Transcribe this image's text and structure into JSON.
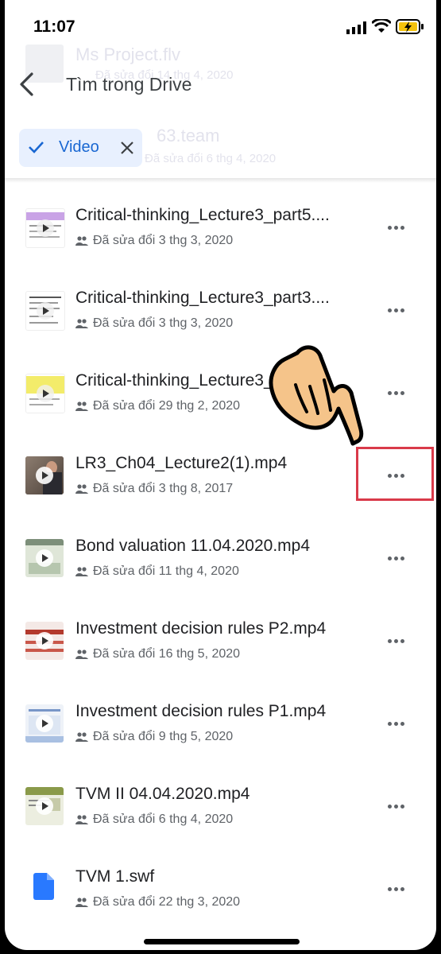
{
  "status_bar": {
    "time": "11:07"
  },
  "header": {
    "title": "Tìm trong Drive"
  },
  "filter_chip": {
    "label": "Video"
  },
  "background_ghost": [
    {
      "name": "Ms Project.flv",
      "meta": "Đã sửa đổi 14 thg 4, 2020"
    },
    {
      "name": "63.team",
      "meta": "Đã sửa đổi 6 thg 4, 2020"
    }
  ],
  "files": [
    {
      "name": "Critical-thinking_Lecture3_part5....",
      "meta": "Đã sửa đổi 3 thg 3, 2020",
      "thumb": "doc-purple"
    },
    {
      "name": "Critical-thinking_Lecture3_part3....",
      "meta": "Đã sửa đổi 3 thg 3, 2020",
      "thumb": "doc-white"
    },
    {
      "name": "Critical-thinking_Lecture3_part3....",
      "meta": "Đã sửa đổi 29 thg 2, 2020",
      "thumb": "doc-yellow"
    },
    {
      "name": "LR3_Ch04_Lecture2(1).mp4",
      "meta": "Đã sửa đổi 3 thg 8, 2017",
      "thumb": "video-person"
    },
    {
      "name": "Bond valuation 11.04.2020.mp4",
      "meta": "Đã sửa đổi 11 thg 4, 2020",
      "thumb": "video-green"
    },
    {
      "name": "Investment decision rules P2.mp4",
      "meta": "Đã sửa đổi 16 thg 5, 2020",
      "thumb": "video-red"
    },
    {
      "name": "Investment decision rules P1.mp4",
      "meta": "Đã sửa đổi 9 thg 5, 2020",
      "thumb": "video-blue"
    },
    {
      "name": "TVM II 04.04.2020.mp4",
      "meta": "Đã sửa đổi 6 thg 4, 2020",
      "thumb": "video-olive"
    },
    {
      "name": "TVM 1.swf",
      "meta": "Đã sửa đổi 22 thg 3, 2020",
      "thumb": "file-icon"
    }
  ],
  "colors": {
    "accent": "#1967d2",
    "chip_bg": "#e8f0fe",
    "highlight": "#d93a4a"
  }
}
